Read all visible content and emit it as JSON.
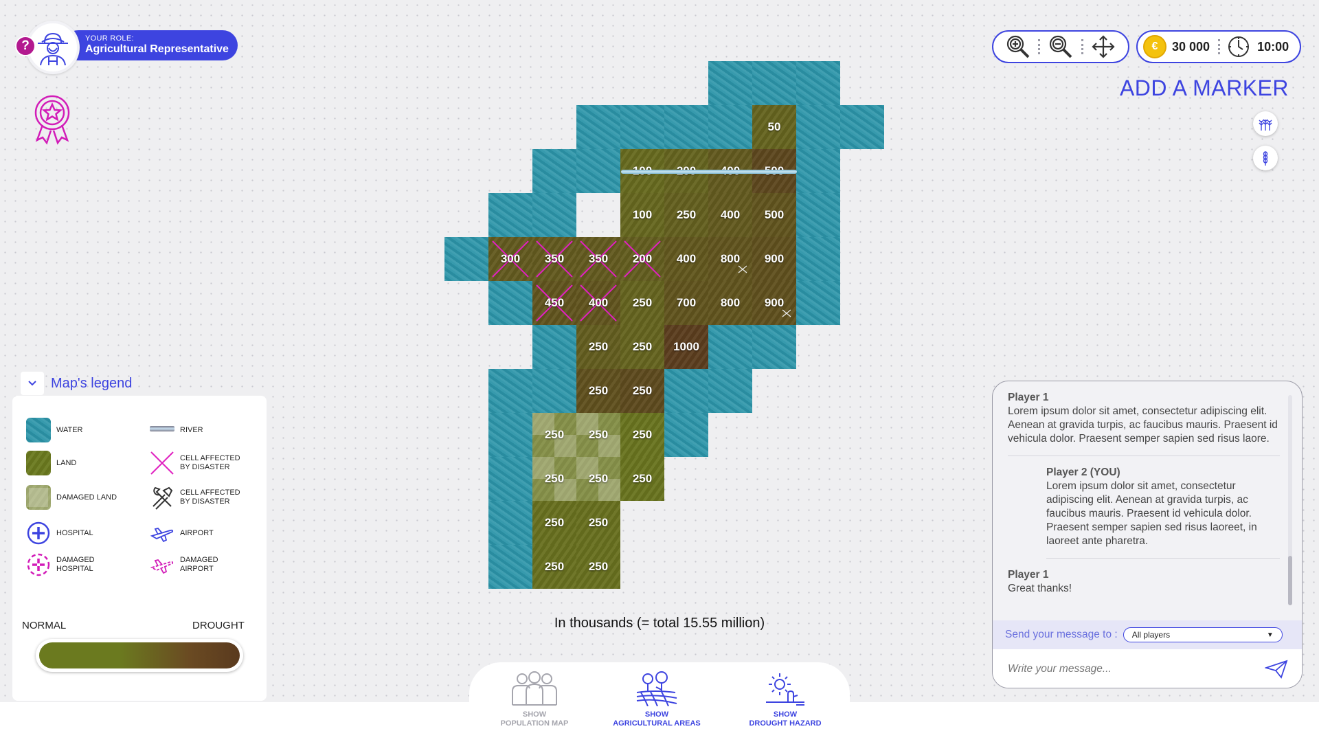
{
  "role": {
    "help": "?",
    "caption": "YOUR ROLE:",
    "name": "Agricultural Representative"
  },
  "toolbar": {
    "tools": [
      "zoom-in-icon",
      "zoom-out-icon",
      "move-icon"
    ],
    "coins": "30 000",
    "coin_symbol": "€",
    "timer": "10:00"
  },
  "markers": {
    "title": "ADD A MARKER",
    "icons": [
      "wheat-field-icon",
      "wheat-stalk-icon"
    ]
  },
  "map": {
    "caption": "In thousands (= total 15.55 million)",
    "colors": {
      "water": "#2b94a8",
      "land_normal": "#6b7a1f",
      "land_drought": "#5a3a1e",
      "disaster": "#e020c0"
    },
    "water_cells": [
      [
        6,
        0
      ],
      [
        7,
        0
      ],
      [
        8,
        0
      ],
      [
        3,
        1
      ],
      [
        4,
        1
      ],
      [
        5,
        1
      ],
      [
        6,
        1
      ],
      [
        8,
        1
      ],
      [
        9,
        1
      ],
      [
        2,
        2
      ],
      [
        3,
        2
      ],
      [
        8,
        2
      ],
      [
        1,
        3
      ],
      [
        2,
        3
      ],
      [
        8,
        3
      ],
      [
        0,
        4
      ],
      [
        8,
        4
      ],
      [
        1,
        5
      ],
      [
        8,
        5
      ],
      [
        2,
        6
      ],
      [
        6,
        6
      ],
      [
        7,
        6
      ],
      [
        1,
        7
      ],
      [
        2,
        7
      ],
      [
        5,
        7
      ],
      [
        6,
        7
      ],
      [
        1,
        8
      ],
      [
        5,
        8
      ],
      [
        1,
        9
      ],
      [
        1,
        10
      ],
      [
        1,
        11
      ]
    ],
    "land_cells": [
      {
        "c": 7,
        "r": 1,
        "v": "50",
        "drought": 0.35
      },
      {
        "c": 4,
        "r": 2,
        "v": "100",
        "drought": 0.25
      },
      {
        "c": 5,
        "r": 2,
        "v": "200",
        "drought": 0.35
      },
      {
        "c": 6,
        "r": 2,
        "v": "400",
        "drought": 0.5
      },
      {
        "c": 7,
        "r": 2,
        "v": "500",
        "drought": 0.8
      },
      {
        "c": 4,
        "r": 3,
        "v": "100",
        "drought": 0.3
      },
      {
        "c": 5,
        "r": 3,
        "v": "250",
        "drought": 0.4
      },
      {
        "c": 6,
        "r": 3,
        "v": "400",
        "drought": 0.5
      },
      {
        "c": 7,
        "r": 3,
        "v": "500",
        "drought": 0.6
      },
      {
        "c": 1,
        "r": 4,
        "v": "300",
        "drought": 0.5,
        "affected": true
      },
      {
        "c": 2,
        "r": 4,
        "v": "350",
        "drought": 0.5,
        "affected": true
      },
      {
        "c": 3,
        "r": 4,
        "v": "350",
        "drought": 0.5,
        "affected": true
      },
      {
        "c": 4,
        "r": 4,
        "v": "200",
        "drought": 0.45,
        "affected": true
      },
      {
        "c": 5,
        "r": 4,
        "v": "400",
        "drought": 0.55
      },
      {
        "c": 6,
        "r": 4,
        "v": "800",
        "drought": 0.6
      },
      {
        "c": 7,
        "r": 4,
        "v": "900",
        "drought": 0.65
      },
      {
        "c": 2,
        "r": 5,
        "v": "450",
        "drought": 0.6,
        "affected": true
      },
      {
        "c": 3,
        "r": 5,
        "v": "400",
        "drought": 0.6,
        "affected": true
      },
      {
        "c": 4,
        "r": 5,
        "v": "250",
        "drought": 0.35
      },
      {
        "c": 5,
        "r": 5,
        "v": "700",
        "drought": 0.6
      },
      {
        "c": 6,
        "r": 5,
        "v": "800",
        "drought": 0.6
      },
      {
        "c": 7,
        "r": 5,
        "v": "900",
        "drought": 0.65
      },
      {
        "c": 3,
        "r": 6,
        "v": "250",
        "drought": 0.45
      },
      {
        "c": 4,
        "r": 6,
        "v": "250",
        "drought": 0.35
      },
      {
        "c": 5,
        "r": 6,
        "v": "1000",
        "drought": 0.95
      },
      {
        "c": 3,
        "r": 7,
        "v": "250",
        "drought": 0.65
      },
      {
        "c": 4,
        "r": 7,
        "v": "250",
        "drought": 0.75
      },
      {
        "c": 2,
        "r": 8,
        "v": "250",
        "drought": 0.05,
        "damaged": true
      },
      {
        "c": 3,
        "r": 8,
        "v": "250",
        "drought": 0.05,
        "damaged": true
      },
      {
        "c": 4,
        "r": 8,
        "v": "250",
        "drought": 0.1
      },
      {
        "c": 2,
        "r": 9,
        "v": "250",
        "drought": 0.05,
        "damaged": true
      },
      {
        "c": 3,
        "r": 9,
        "v": "250",
        "drought": 0.05,
        "damaged": true
      },
      {
        "c": 4,
        "r": 9,
        "v": "250",
        "drought": 0.1
      },
      {
        "c": 2,
        "r": 10,
        "v": "250",
        "drought": 0.15
      },
      {
        "c": 3,
        "r": 10,
        "v": "250",
        "drought": 0.15
      },
      {
        "c": 2,
        "r": 11,
        "v": "250",
        "drought": 0.15
      },
      {
        "c": 3,
        "r": 11,
        "v": "250",
        "drought": 0.15
      }
    ],
    "tool_marks": [
      {
        "c": 6,
        "r": 4,
        "icon": "tools-icon"
      },
      {
        "c": 7,
        "r": 5,
        "icon": "airport-icon"
      }
    ]
  },
  "legend": {
    "title": "Map's legend",
    "items": [
      {
        "label": "WATER",
        "icon": "water-swatch"
      },
      {
        "label": "RIVER",
        "icon": "river-icon"
      },
      {
        "label": "LAND",
        "icon": "land-swatch"
      },
      {
        "label": "CELL AFFECTED BY DISASTER",
        "icon": "disaster-cross-icon"
      },
      {
        "label": "DAMAGED LAND",
        "icon": "damaged-land-swatch"
      },
      {
        "label": "CELL AFFECTED BY DISASTER",
        "icon": "tools-icon"
      },
      {
        "label": "HOSPITAL",
        "icon": "hospital-icon"
      },
      {
        "label": "AIRPORT",
        "icon": "airport-icon"
      },
      {
        "label": "DAMAGED HOSPITAL",
        "icon": "damaged-hospital-icon"
      },
      {
        "label": "DAMAGED AIRPORT",
        "icon": "damaged-airport-icon"
      }
    ],
    "scale_normal": "NORMAL",
    "scale_drought": "DROUGHT"
  },
  "chat": {
    "messages": [
      {
        "author": "Player 1",
        "text": "Lorem ipsum dolor sit amet, consectetur adipiscing elit. Aenean at gravida turpis, ac faucibus mauris. Praesent id vehicula dolor. Praesent semper sapien sed risus laore."
      },
      {
        "author": "Player 2 (YOU)",
        "text": "Lorem ipsum dolor sit amet, consectetur adipiscing elit. Aenean at gravida turpis, ac faucibus mauris. Praesent id vehicula dolor. Praesent semper sapien sed risus laoreet, in laoreet ante pharetra."
      },
      {
        "author": "Player 1",
        "text": "Great thanks!"
      }
    ],
    "send_to_label": "Send your message to :",
    "recipient": "All players",
    "input_placeholder": "Write your message..."
  },
  "bottom_nav": [
    {
      "line1": "SHOW",
      "line2": "POPULATION MAP",
      "icon": "population-icon",
      "active": false
    },
    {
      "line1": "SHOW",
      "line2": "AGRICULTURAL AREAS",
      "icon": "agriculture-icon",
      "active": true
    },
    {
      "line1": "SHOW",
      "line2": "DROUGHT HAZARD",
      "icon": "drought-icon",
      "active": true
    }
  ]
}
